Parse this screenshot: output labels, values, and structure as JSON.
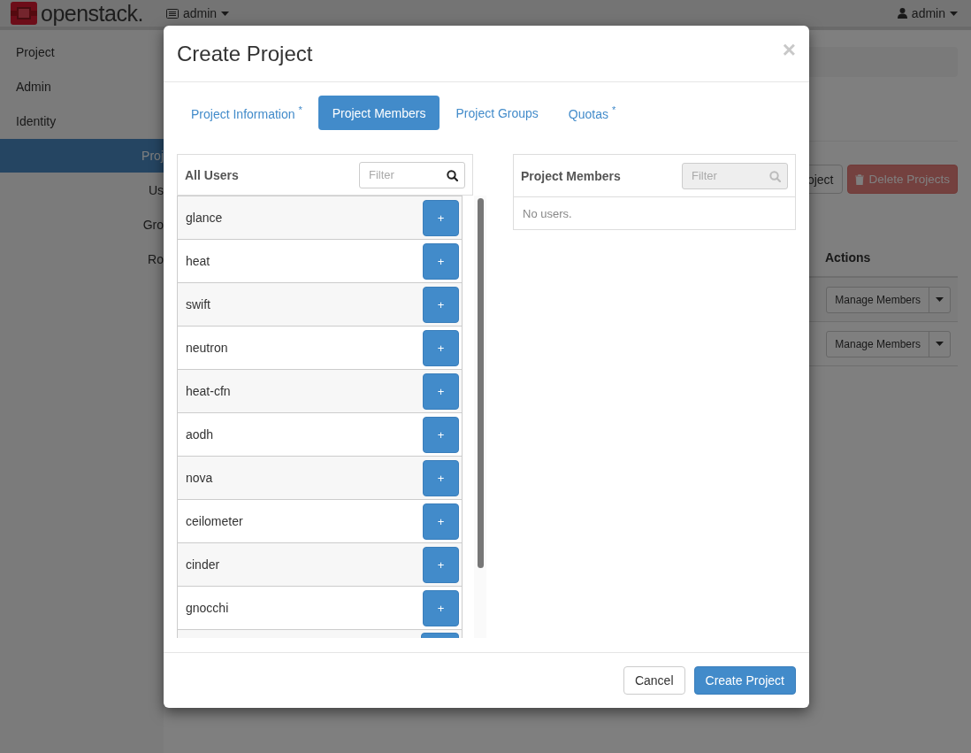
{
  "topbar": {
    "logo_text": "openstack.",
    "project_menu": "admin",
    "user_menu": "admin"
  },
  "sidebar": {
    "items": [
      {
        "label": "Project",
        "selected": false
      },
      {
        "label": "Admin",
        "selected": false
      },
      {
        "label": "Identity",
        "selected": false,
        "children": [
          {
            "label": "Proj",
            "selected": true
          },
          {
            "label": "Us",
            "selected": false
          },
          {
            "label": "Gro",
            "selected": false
          },
          {
            "label": "Ro",
            "selected": false
          }
        ]
      }
    ]
  },
  "main": {
    "toolbar": [
      {
        "label": "oject",
        "kind": "default"
      },
      {
        "label": "Delete Projects",
        "kind": "danger"
      }
    ],
    "table": {
      "columns": [
        "Actions"
      ],
      "rows": [
        {
          "action": "Manage Members"
        },
        {
          "action": "Manage Members"
        }
      ]
    }
  },
  "modal": {
    "title": "Create Project",
    "close": "×",
    "tabs": [
      {
        "label": "Project Information $^{*}$",
        "selected": false
      },
      {
        "label": "Project Members",
        "selected": true
      },
      {
        "label": "Project Groups",
        "selected": false
      },
      {
        "label": "Quotas $^{*}$",
        "selected": false
      }
    ],
    "all_users": {
      "title": "All Users",
      "filter": {
        "placeholder": "Filter",
        "disabled": false
      },
      "users": [
        {
          "kind": "user",
          "name": "glance",
          "action": "+"
        },
        {
          "kind": "user",
          "name": "heat",
          "action": "+"
        },
        {
          "kind": "user",
          "name": "swift",
          "action": "+"
        },
        {
          "kind": "user",
          "name": "neutron",
          "action": "+"
        },
        {
          "kind": "user",
          "name": "heat-cfn",
          "action": "+"
        },
        {
          "kind": "user",
          "name": "aodh",
          "action": "+"
        },
        {
          "kind": "user",
          "name": "nova",
          "action": "+"
        },
        {
          "kind": "user",
          "name": "ceilometer",
          "action": "+"
        },
        {
          "kind": "user",
          "name": "cinder",
          "action": "+"
        },
        {
          "kind": "user",
          "name": "gnocchi",
          "action": "+"
        },
        {
          "kind": "partial"
        }
      ]
    },
    "project_members": {
      "title": "Project Members",
      "filter": {
        "placeholder": "Filter",
        "disabled": true
      },
      "empty": "No users."
    },
    "buttons": [
      {
        "label": "Cancel",
        "kind": "default"
      },
      {
        "label": "Create Project",
        "kind": "primary"
      }
    ]
  }
}
